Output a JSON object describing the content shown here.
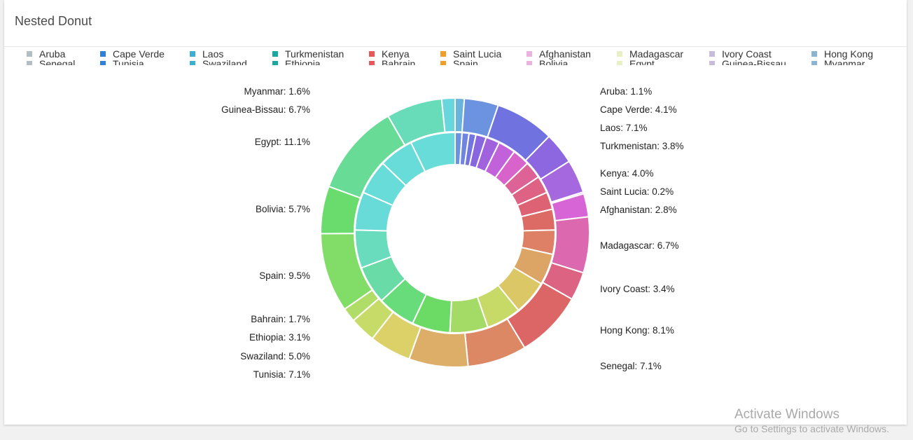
{
  "card": {
    "title": "Nested Donut"
  },
  "legend": {
    "row1": [
      "Aruba",
      "Cape Verde",
      "Laos",
      "Turkmenistan",
      "Kenya",
      "Saint Lucia",
      "Afghanistan",
      "Madagascar",
      "Ivory Coast",
      "Hong Kong"
    ],
    "row1_colors": [
      "#b4bcc4",
      "#2f80d8",
      "#3bb0d0",
      "#17a8a0",
      "#e85858",
      "#f39c28",
      "#eab2de",
      "#e6f2c6",
      "#c8bcdc",
      "#8ab4d4"
    ],
    "row2": [
      "Senegal",
      "Tunisia",
      "Swaziland",
      "Ethiopia",
      "Bahrain",
      "Spain",
      "Bolivia",
      "Egypt",
      "Guinea-Bissau",
      "Myanmar"
    ],
    "row2_colors": [
      "#b4bcc4",
      "#2f80d8",
      "#3bb0d0",
      "#17a8a0",
      "#e85858",
      "#f39c28",
      "#eab2de",
      "#e6f2c6",
      "#c8bcdc",
      "#8ab4d4"
    ]
  },
  "watermark": {
    "title": "Activate Windows",
    "subtitle": "Go to Settings to activate Windows."
  },
  "chart_data": {
    "type": "pie",
    "title": "Nested Donut",
    "inner_ring": {
      "values": [
        1,
        1,
        1,
        1.5,
        2,
        2.5,
        2.5,
        2.5,
        2.5,
        2.5,
        3,
        3.5,
        4.5,
        5,
        5,
        5.5,
        5.5,
        5.5,
        5.5,
        5.5,
        5.5,
        5,
        5,
        6.5
      ],
      "colors": [
        "#6c93e0",
        "#6f85e0",
        "#7374df",
        "#8766df",
        "#a063dd",
        "#c262db",
        "#d863ca",
        "#dd6396",
        "#dd6283",
        "#dd6374",
        "#dc6a65",
        "#dd8065",
        "#dca566",
        "#dcc767",
        "#c7da67",
        "#a4db66",
        "#6bdb66",
        "#68db7a",
        "#68dba6",
        "#68dcbd",
        "#68dbd9",
        "#68dcd9",
        "#68dcd9",
        "#68dcd9"
      ]
    },
    "outer_ring": {
      "series": [
        {
          "name": "Aruba",
          "value": 1.1,
          "color": "#68b4dc"
        },
        {
          "name": "Cape Verde",
          "value": 4.1,
          "color": "#6c93e0"
        },
        {
          "name": "Laos",
          "value": 7.1,
          "color": "#6f72df"
        },
        {
          "name": "Turkmenistan",
          "value": 3.8,
          "color": "#8c67df"
        },
        {
          "name": "Kenya",
          "value": 4.0,
          "color": "#a568de"
        },
        {
          "name": "Saint Lucia",
          "value": 0.2,
          "color": "#c264dc"
        },
        {
          "name": "Afghanistan",
          "value": 2.8,
          "color": "#d765d6"
        },
        {
          "name": "Madagascar",
          "value": 6.7,
          "color": "#dc68b0"
        },
        {
          "name": "Ivory Coast",
          "value": 3.4,
          "color": "#dc6482"
        },
        {
          "name": "Hong Kong",
          "value": 8.1,
          "color": "#dc6565"
        },
        {
          "name": "Senegal",
          "value": 7.1,
          "color": "#dc8864"
        },
        {
          "name": "Tunisia",
          "value": 7.1,
          "color": "#dcae68"
        },
        {
          "name": "Swaziland",
          "value": 5.0,
          "color": "#dcd168"
        },
        {
          "name": "Ethiopia",
          "value": 3.1,
          "color": "#c7dc68"
        },
        {
          "name": "Bahrain",
          "value": 1.7,
          "color": "#b0dc68"
        },
        {
          "name": "Spain",
          "value": 9.5,
          "color": "#82dc68"
        },
        {
          "name": "Bolivia",
          "value": 5.7,
          "color": "#6adc6e"
        },
        {
          "name": "Egypt",
          "value": 11.1,
          "color": "#68dc96"
        },
        {
          "name": "Guinea-Bissau",
          "value": 6.7,
          "color": "#68dcb8"
        },
        {
          "name": "Myanmar",
          "value": 1.6,
          "color": "#68d6dc"
        }
      ]
    },
    "labels": {
      "Aruba": "Aruba: 1.1%",
      "Cape Verde": "Cape Verde: 4.1%",
      "Laos": "Laos: 7.1%",
      "Turkmenistan": "Turkmenistan: 3.8%",
      "Kenya": "Kenya: 4.0%",
      "Saint Lucia": "Saint Lucia: 0.2%",
      "Afghanistan": "Afghanistan: 2.8%",
      "Madagascar": "Madagascar: 6.7%",
      "Ivory Coast": "Ivory Coast: 3.4%",
      "Hong Kong": "Hong Kong: 8.1%",
      "Senegal": "Senegal: 7.1%",
      "Tunisia": "Tunisia: 7.1%",
      "Swaziland": "Swaziland: 5.0%",
      "Ethiopia": "Ethiopia: 3.1%",
      "Bahrain": "Bahrain: 1.7%",
      "Spain": "Spain: 9.5%",
      "Bolivia": "Bolivia: 5.7%",
      "Egypt": "Egypt: 11.1%",
      "Guinea-Bissau": "Guinea-Bissau: 6.7%",
      "Myanmar": "Myanmar: 1.6%"
    },
    "legend_position": "top"
  }
}
